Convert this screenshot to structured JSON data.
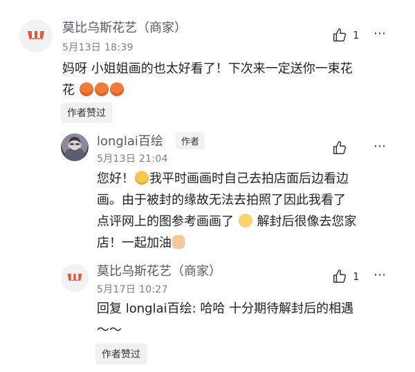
{
  "comments": [
    {
      "author": "莫比乌斯花艺（商家）",
      "date": "5月13日  18:39",
      "text_parts": [
        "妈呀 小姐姐画的也太好看了！下次来一定送你一束花",
        "花"
      ],
      "like_count": "1",
      "badge": "作者赞过"
    },
    {
      "author": "longlai百绘",
      "author_tag": "作者",
      "date": "5月13日  21:04",
      "text_parts": [
        "您好！",
        "我平时画画时自己去拍店面后边看边",
        "画。由于被封的缘故无法去拍照了因此我看了",
        "点评网上的图参考画画了",
        "解封后很像去您家",
        "店！一起加油"
      ]
    },
    {
      "author": "莫比乌斯花艺（商家）",
      "date": "5月17日  10:27",
      "reply_prefix": "回复 ",
      "reply_to": "longlai百绘:",
      "text_parts": [
        " 哈哈 十分期待解封后的相遇",
        "～～"
      ],
      "like_count": "1",
      "badge": "作者赞过"
    }
  ],
  "icons": {
    "more": "⋯",
    "like": "thumbs-up-outline-icon",
    "shop": "storefront-awning-icon"
  },
  "colors": {
    "name_gray": "#555a66",
    "awning_red": "#e8553d",
    "badge_bg": "#f1f1f1"
  }
}
